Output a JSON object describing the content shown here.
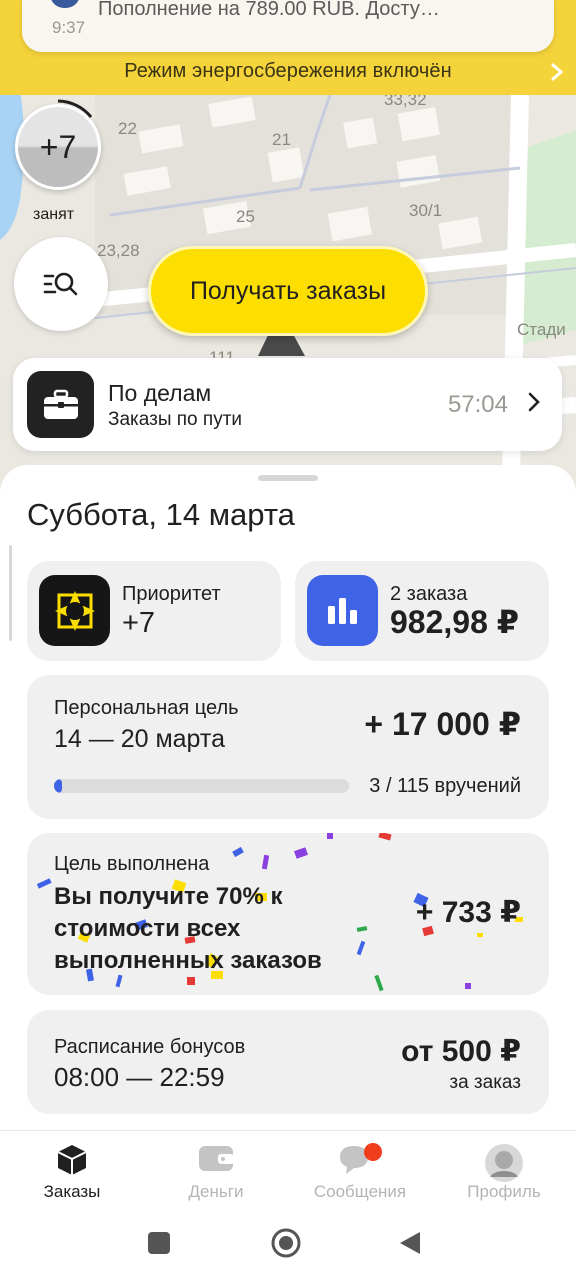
{
  "notification": {
    "text": "Пополнение на 789.00 RUB. Досту…",
    "time": "9:37"
  },
  "energy_banner": {
    "text": "Режим энергосбережения включён"
  },
  "map": {
    "labels": [
      "33,32",
      "22",
      "21",
      "25",
      "30/1",
      "23,28",
      "111",
      "Стади"
    ]
  },
  "priority_indicator": {
    "value": "+7",
    "status": "занят"
  },
  "get_orders_button": {
    "label": "Получать заказы"
  },
  "on_the_way": {
    "title": "По делам",
    "subtitle": "Заказы по пути",
    "timer": "57:04"
  },
  "sheet": {
    "date": "Суббота, 14 марта",
    "priority_card": {
      "label": "Приоритет",
      "value": "+7"
    },
    "orders_card": {
      "label": "2 заказа",
      "value": "982,98 ₽"
    },
    "personal_goal": {
      "label": "Персональная цель",
      "dates": "14 — 20 марта",
      "amount": "+ 17 000 ₽",
      "progress_text": "3 / 115 вручений",
      "progress_fraction": 0.026
    },
    "goal_done": {
      "label": "Цель выполнена",
      "text": "Вы получите 70% к стоимости всех выполненных заказов",
      "amount": "+ 733 ₽"
    },
    "bonus_schedule": {
      "label": "Расписание бонусов",
      "time": "08:00 — 22:59",
      "amount": "от 500 ₽",
      "per": "за заказ"
    }
  },
  "tabs": [
    {
      "label": "Заказы",
      "icon": "box-icon",
      "active": true
    },
    {
      "label": "Деньги",
      "icon": "wallet-icon",
      "active": false
    },
    {
      "label": "Сообщения",
      "icon": "chat-icon",
      "active": false
    },
    {
      "label": "Профиль",
      "icon": "avatar-icon",
      "active": false
    }
  ],
  "colors": {
    "accent_yellow": "#fcdf00",
    "blue": "#3f63e6",
    "badge_red": "#f03d1c",
    "banner_yellow": "#f5d33b"
  }
}
